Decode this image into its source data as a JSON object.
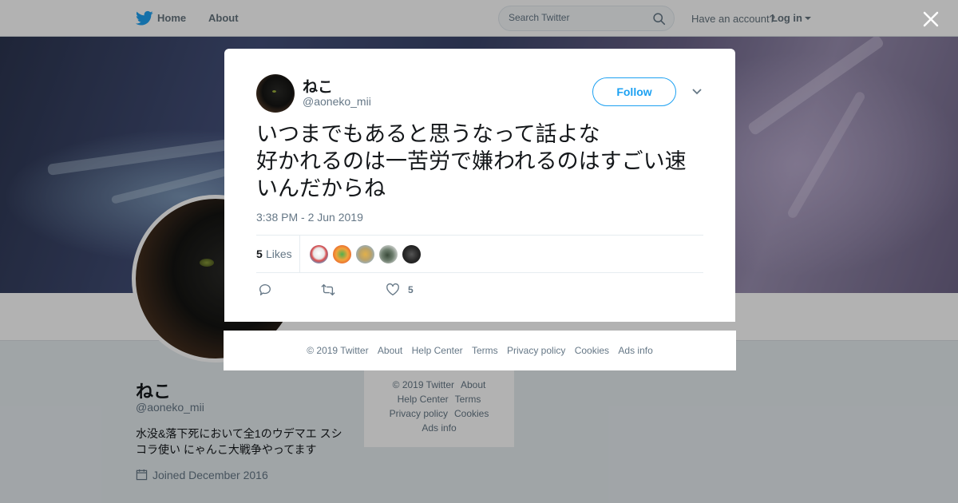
{
  "nav": {
    "home_label": "Home",
    "about_label": "About",
    "search_placeholder": "Search Twitter",
    "have_account_label": "Have an account?",
    "login_label": "Log in"
  },
  "profile": {
    "name": "ねこ",
    "handle": "@aoneko_mii",
    "bio": "水没&落下死において全1のウデマエ スシコラ使い にゃんこ大戦争やってます",
    "joined": "Joined December 2016"
  },
  "side_footer": {
    "links": [
      "© 2019 Twitter",
      "About",
      "Help Center",
      "Terms",
      "Privacy policy",
      "Cookies",
      "Ads info"
    ]
  },
  "tweet": {
    "author_name": "ねこ",
    "author_handle": "@aoneko_mii",
    "follow_label": "Follow",
    "text_lines": [
      "いつまでもあると思うなって話よな",
      "好かれるのは一苦労で嫌われるのはすごい速",
      "いんだからね"
    ],
    "timestamp": "3:38 PM - 2 Jun 2019",
    "likes_count": "5",
    "likes_label": "Likes",
    "action_like_count": "5"
  },
  "modal_footer": {
    "links": [
      "© 2019 Twitter",
      "About",
      "Help Center",
      "Terms",
      "Privacy policy",
      "Cookies",
      "Ads info"
    ]
  },
  "colors": {
    "accent": "#1da1f2",
    "muted_text": "#657786"
  },
  "icons": [
    "twitter-bird-icon",
    "search-icon",
    "caret-down-icon",
    "close-icon",
    "reply-icon",
    "retweet-icon",
    "heart-icon",
    "calendar-icon"
  ]
}
